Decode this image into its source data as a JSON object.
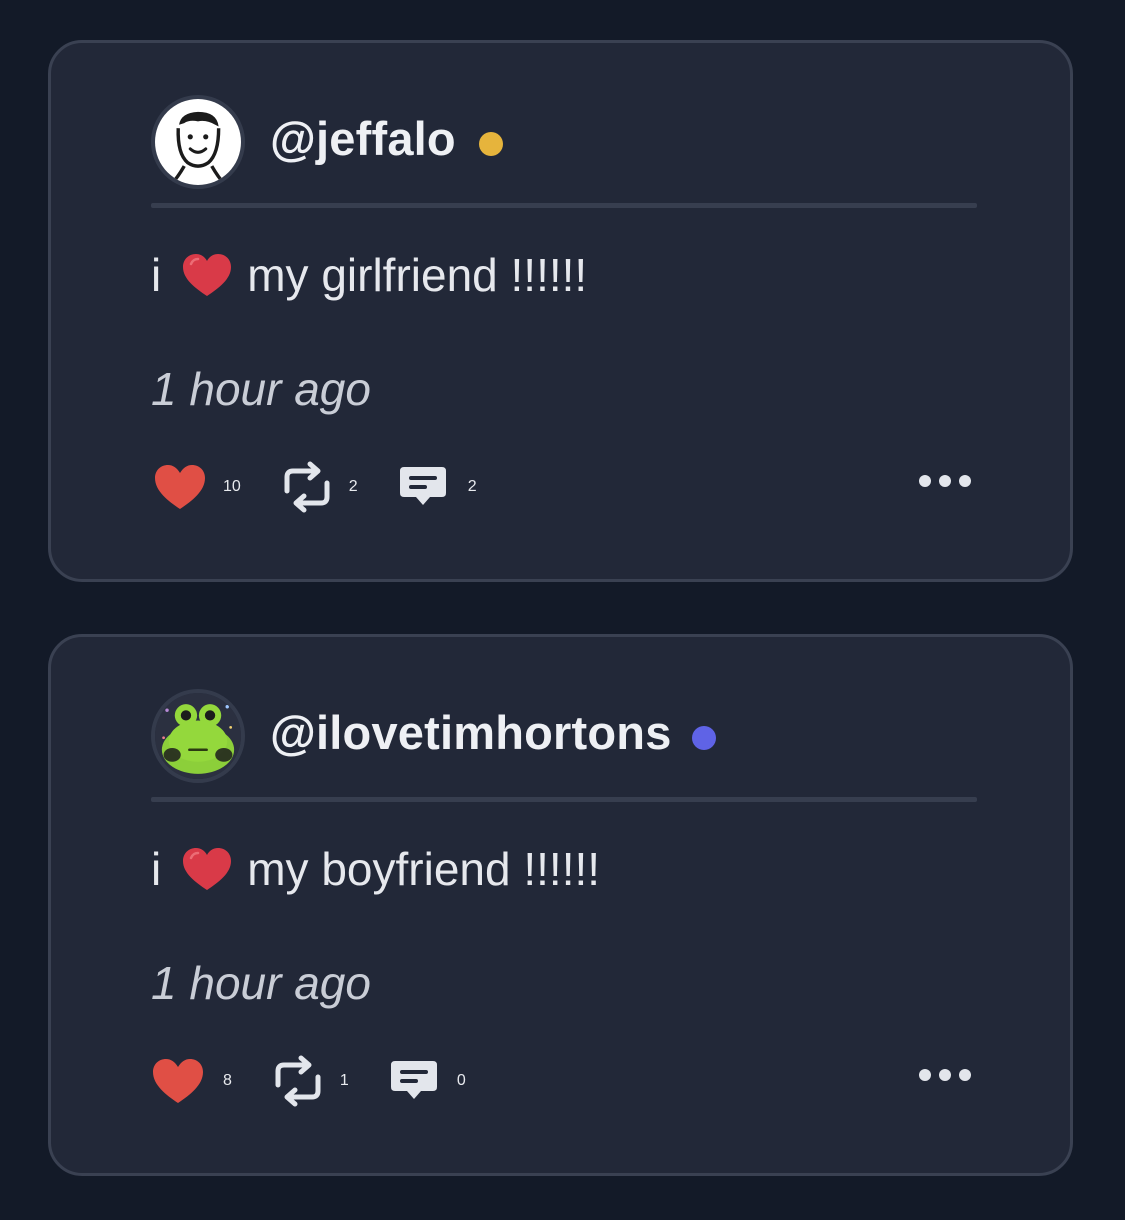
{
  "posts": [
    {
      "username": "@jeffalo",
      "status_color": "#e6b43c",
      "text_before": "i",
      "emoji": "red-heart",
      "text_after": "my girlfriend !!!!!!",
      "timestamp": "1 hour ago",
      "likes": "10",
      "reposts": "2",
      "comments": "2",
      "avatar": "smiley-face-avatar"
    },
    {
      "username": "@ilovetimhortons",
      "status_color": "#5f63e6",
      "text_before": "i",
      "emoji": "red-heart",
      "text_after": "my boyfriend !!!!!!",
      "timestamp": "1 hour ago",
      "likes": "8",
      "reposts": "1",
      "comments": "0",
      "avatar": "green-frog-avatar"
    }
  ],
  "colors": {
    "background": "#131a28",
    "card": "#222838",
    "card_border": "#3a4152",
    "like": "#e04f45",
    "emoji_heart": "#d93a48"
  },
  "icons": {
    "like": "heart-icon",
    "repost": "repost-icon",
    "comment": "comment-icon",
    "more": "more-options-icon"
  }
}
